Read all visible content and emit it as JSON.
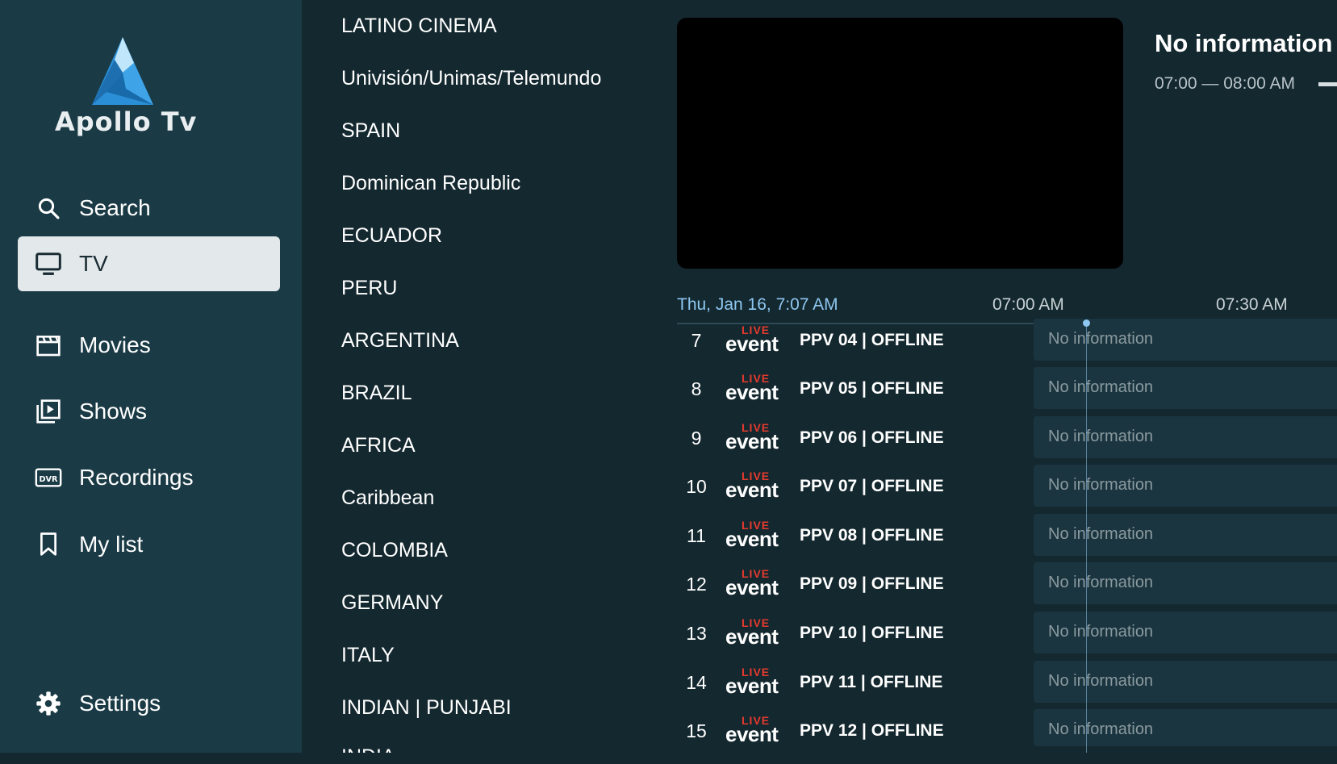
{
  "app": {
    "name": "Apollo Tv"
  },
  "colors": {
    "sidebar_bg": "#1a3a45",
    "main_bg": "#14282f",
    "active_item_bg": "#e3e8eb",
    "accent_blue": "#8ec7f0",
    "live_red": "#e53a2e"
  },
  "sidebar": {
    "items": [
      {
        "label": "Search",
        "icon": "search-icon"
      },
      {
        "label": "TV",
        "icon": "tv-icon",
        "active": true
      },
      {
        "label": "Movies",
        "icon": "clapperboard-icon"
      },
      {
        "label": "Shows",
        "icon": "shows-icon"
      },
      {
        "label": "Recordings",
        "icon": "dvr-icon"
      },
      {
        "label": "My list",
        "icon": "bookmark-icon"
      }
    ],
    "settings": {
      "label": "Settings",
      "icon": "gear-icon"
    }
  },
  "categories": [
    "LATINO CINEMA",
    "Univisión/Unimas/Telemundo",
    "SPAIN",
    "Dominican Republic",
    "ECUADOR",
    "PERU",
    "ARGENTINA",
    "BRAZIL",
    "AFRICA",
    "Caribbean",
    "COLOMBIA",
    "GERMANY",
    "ITALY",
    "INDIAN | PUNJABI",
    "INDIA"
  ],
  "program_info": {
    "title": "No information",
    "time_range": "07:00 — 08:00 AM"
  },
  "timeline": {
    "current_datetime": "Thu, Jan 16, 7:07 AM",
    "ticks": [
      "07:00 AM",
      "07:30 AM"
    ]
  },
  "channel_logo": {
    "live_text": "LIVE",
    "event_text": "event"
  },
  "channels": [
    {
      "number": "7",
      "name": "PPV 04 |  OFFLINE",
      "program": "No information"
    },
    {
      "number": "8",
      "name": "PPV 05 | OFFLINE",
      "program": "No information"
    },
    {
      "number": "9",
      "name": "PPV 06 | OFFLINE",
      "program": "No information"
    },
    {
      "number": "10",
      "name": "PPV 07 | OFFLINE",
      "program": "No information"
    },
    {
      "number": "11",
      "name": "PPV 08 |  OFFLINE",
      "program": "No information"
    },
    {
      "number": "12",
      "name": "PPV 09 | OFFLINE",
      "program": "No information"
    },
    {
      "number": "13",
      "name": "PPV 10 | OFFLINE",
      "program": "No information"
    },
    {
      "number": "14",
      "name": "PPV 11 | OFFLINE",
      "program": "No information"
    },
    {
      "number": "15",
      "name": "PPV 12 | OFFLINE",
      "program": "No information"
    }
  ]
}
